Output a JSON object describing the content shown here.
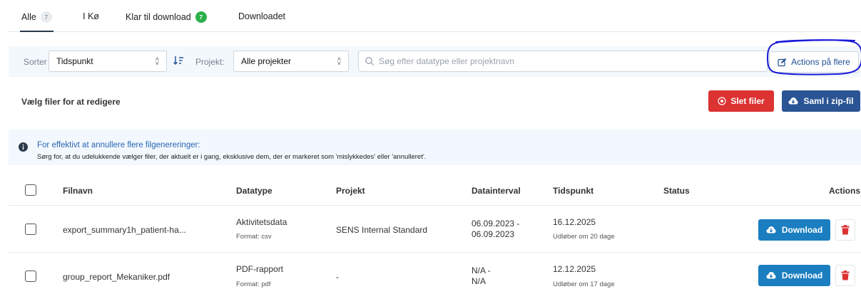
{
  "tabs": [
    {
      "label": "Alle",
      "badge": "7"
    },
    {
      "label": "I Kø",
      "badge": ""
    },
    {
      "label": "Klar til download",
      "badge": "7"
    },
    {
      "label": "Downloadet",
      "badge": ""
    }
  ],
  "filters": {
    "sort_label": "Sorter",
    "sort_value": "Tidspunkt",
    "project_label": "Projekt:",
    "project_value": "Alle projekter",
    "search_placeholder": "Søg efter datatype eller projektnavn",
    "actions_label": "Actions på flere"
  },
  "edit": {
    "title": "Vælg filer for at redigere",
    "delete_label": "Slet filer",
    "zip_label": "Saml i zip-fil"
  },
  "info": {
    "title": "For effektivt at annullere flere filgenereringer:",
    "body": "Sørg for, at du udelukkende vælger filer, der aktuelt er i gang, eksklusive dem, der er markeret som 'mislykkedes' eller 'annulleret'."
  },
  "table": {
    "headers": {
      "filename": "Filnavn",
      "datatype": "Datatype",
      "project": "Projekt",
      "interval": "Datainterval",
      "time": "Tidspunkt",
      "status": "Status",
      "actions": "Actions"
    },
    "rows": [
      {
        "filename": "export_summary1h_patient-ha...",
        "datatype": "Aktivitetsdata",
        "format": "Format: csv",
        "project": "SENS Internal Standard",
        "interval_1": "06.09.2023 -",
        "interval_2": "06.09.2023",
        "time": "16.12.2025",
        "expiry": "Udløber om 20 dage",
        "status": "",
        "download_label": "Download"
      },
      {
        "filename": "group_report_Mekaniker.pdf",
        "datatype": "PDF-rapport",
        "format": "Format: pdf",
        "project": "-",
        "interval_1": "N/A -",
        "interval_2": "N/A",
        "time": "12.12.2025",
        "expiry": "Udløber om 17 dage",
        "status": "",
        "download_label": "Download"
      }
    ]
  },
  "colors": {
    "accent_blue": "#2a5494",
    "download_blue": "#1b7ec0",
    "danger_red": "#dc3232",
    "success_green": "#2bb04a",
    "annotation_blue": "#1a1ad9"
  }
}
